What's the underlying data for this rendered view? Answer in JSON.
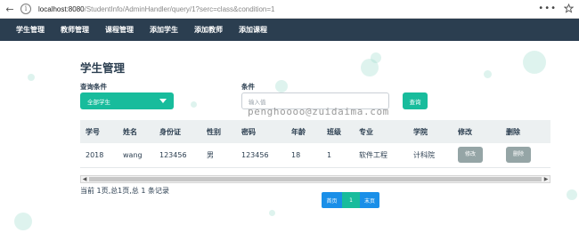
{
  "browser": {
    "url_host": "localhost:8080",
    "url_path": "/StudentInfo/AdminHandler/query/1?serc=class&condition=1"
  },
  "nav": {
    "items": [
      "学生管理",
      "教师管理",
      "课程管理",
      "添加学生",
      "添加教师",
      "添加课程"
    ]
  },
  "page": {
    "title": "学生管理"
  },
  "query": {
    "condition_label": "查询条件",
    "select_value": "全部学生",
    "field_label": "条件",
    "input_placeholder": "输入值",
    "button_label": "查询"
  },
  "watermark": "penghoooo@zuidaima.com",
  "table": {
    "headers": [
      "学号",
      "姓名",
      "身份证",
      "性别",
      "密码",
      "年龄",
      "班级",
      "专业",
      "学院",
      "修改",
      "删除"
    ],
    "rows": [
      {
        "id": "2018",
        "name": "wang",
        "idcard": "123456",
        "gender": "男",
        "password": "123456",
        "age": "18",
        "class": "1",
        "major": "软件工程",
        "college": "计科院",
        "edit_label": "修改",
        "delete_label": "删除"
      }
    ]
  },
  "summary": "当前 1页,总1页,总 1 条记录",
  "pagination": {
    "first_label": "首页",
    "current_page": "1",
    "last_label": "末页"
  },
  "colors": {
    "navbar": "#2b3e50",
    "accent": "#18bc9c",
    "pager_blue": "#1a8fe8",
    "disabled_button": "#95a5a6"
  },
  "icons": [
    "back-arrow-icon",
    "info-icon",
    "more-icon",
    "bookmark-star-icon",
    "dropdown-caret-icon",
    "scroll-left-icon",
    "scroll-right-icon"
  ]
}
